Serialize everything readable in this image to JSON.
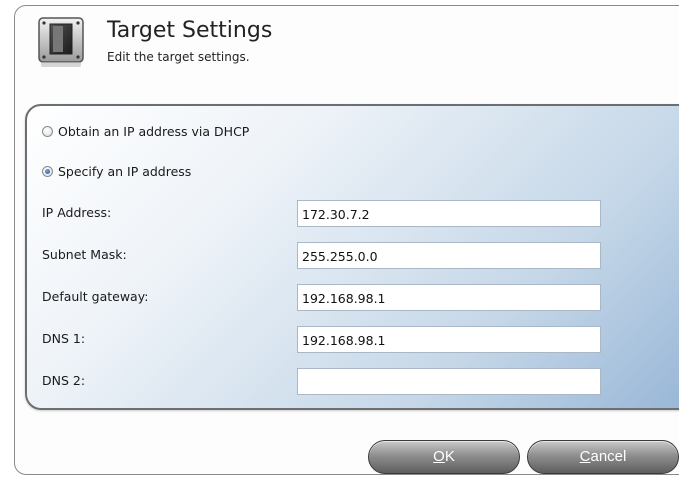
{
  "header": {
    "title": "Target Settings",
    "subtitle": "Edit the target settings.",
    "icon": "device-settings-icon"
  },
  "ip_mode": {
    "options": [
      {
        "label": "Obtain an IP address via DHCP",
        "selected": false
      },
      {
        "label": "Specify an IP address",
        "selected": true
      }
    ]
  },
  "fields": {
    "ip_address": {
      "label": "IP Address:",
      "value": "172.30.7.2"
    },
    "subnet_mask": {
      "label": "Subnet Mask:",
      "value": "255.255.0.0"
    },
    "default_gateway": {
      "label": "Default gateway:",
      "value": "192.168.98.1"
    },
    "dns1": {
      "label": "DNS 1:",
      "value": "192.168.98.1"
    },
    "dns2": {
      "label": "DNS 2:",
      "value": ""
    }
  },
  "buttons": {
    "ok": {
      "mnemonic": "O",
      "rest": "K"
    },
    "cancel": {
      "mnemonic": "C",
      "rest": "ancel"
    }
  },
  "colors": {
    "panel_gradient_end": "#96b5d6",
    "button_dark": "#5e5e5e"
  }
}
